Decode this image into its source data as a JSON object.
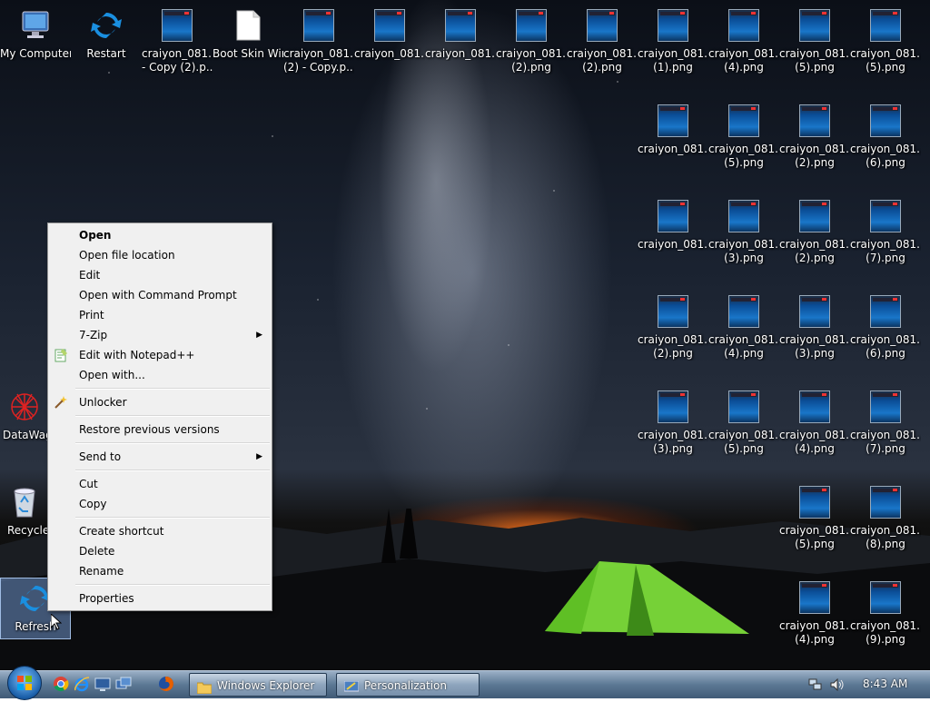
{
  "desktop": {
    "icons": [
      {
        "label": "My Computer",
        "type": "computer"
      },
      {
        "label": "Restart",
        "type": "refresh"
      },
      {
        "label": "craiyon_081... - Copy (2).p...",
        "type": "thumb"
      },
      {
        "label": "Boot Skin Windo...",
        "type": "file"
      },
      {
        "label": "craiyon_081... (2) - Copy.p...",
        "type": "thumb"
      },
      {
        "label": "craiyon_081...",
        "type": "thumb"
      },
      {
        "label": "craiyon_081...",
        "type": "thumb"
      },
      {
        "label": "craiyon_081... (2).png",
        "type": "thumb"
      },
      {
        "label": "craiyon_081... (2).png",
        "type": "thumb"
      },
      {
        "label": "craiyon_081... (1).png",
        "type": "thumb"
      },
      {
        "label": "craiyon_081... (4).png",
        "type": "thumb"
      },
      {
        "label": "craiyon_081... (5).png",
        "type": "thumb"
      },
      {
        "label": "craiyon_081... (5).png",
        "type": "thumb"
      },
      {
        "label": "craiyon_081...",
        "type": "thumb"
      },
      {
        "label": "craiyon_081... (5).png",
        "type": "thumb"
      },
      {
        "label": "craiyon_081... (2).png",
        "type": "thumb"
      },
      {
        "label": "craiyon_081... (6).png",
        "type": "thumb"
      },
      {
        "label": "craiyon_081...",
        "type": "thumb"
      },
      {
        "label": "craiyon_081... (3).png",
        "type": "thumb"
      },
      {
        "label": "craiyon_081... (2).png",
        "type": "thumb"
      },
      {
        "label": "craiyon_081... (7).png",
        "type": "thumb"
      },
      {
        "label": "craiyon_081... (2).png",
        "type": "thumb"
      },
      {
        "label": "craiyon_081... (4).png",
        "type": "thumb"
      },
      {
        "label": "craiyon_081... (3).png",
        "type": "thumb"
      },
      {
        "label": "craiyon_081... (6).png",
        "type": "thumb"
      },
      {
        "label": "craiyon_081... (3).png",
        "type": "thumb"
      },
      {
        "label": "craiyon_081... (5).png",
        "type": "thumb"
      },
      {
        "label": "craiyon_081... (4).png",
        "type": "thumb"
      },
      {
        "label": "craiyon_081... (7).png",
        "type": "thumb"
      },
      {
        "label": "craiyon_081... (5).png",
        "type": "thumb"
      },
      {
        "label": "craiyon_081... (8).png",
        "type": "thumb"
      },
      {
        "label": "craiyon_081... (4).png",
        "type": "thumb"
      },
      {
        "label": "craiyon_081... (9).png",
        "type": "thumb"
      },
      {
        "label": "DataWag",
        "type": "datawag"
      },
      {
        "label": "Recycle",
        "type": "recycle"
      },
      {
        "label": "Refresh",
        "type": "refresh"
      }
    ]
  },
  "context_menu": {
    "items": [
      {
        "label": "Open",
        "bold": true
      },
      {
        "label": "Open file location"
      },
      {
        "label": "Edit"
      },
      {
        "label": "Open with Command Prompt"
      },
      {
        "label": "Print"
      },
      {
        "label": "7-Zip",
        "submenu": true
      },
      {
        "label": "Edit with Notepad++",
        "icon": "notepad-icon"
      },
      {
        "label": "Open with..."
      },
      {
        "separator": true
      },
      {
        "label": "Unlocker",
        "icon": "wand-icon"
      },
      {
        "separator": true
      },
      {
        "label": "Restore previous versions"
      },
      {
        "separator": true
      },
      {
        "label": "Send to",
        "submenu": true
      },
      {
        "separator": true
      },
      {
        "label": "Cut"
      },
      {
        "label": "Copy"
      },
      {
        "separator": true
      },
      {
        "label": "Create shortcut"
      },
      {
        "label": "Delete"
      },
      {
        "label": "Rename"
      },
      {
        "separator": true
      },
      {
        "label": "Properties"
      }
    ]
  },
  "taskbar": {
    "quicklaunch": [
      "chrome-icon",
      "ie-icon",
      "show-desktop-icon",
      "switch-windows-icon",
      "firefox-icon"
    ],
    "tasks": [
      {
        "label": "Windows Explorer",
        "icon": "folder-icon"
      },
      {
        "label": "Personalization",
        "icon": "personalization-icon"
      }
    ],
    "clock": "8:43 AM",
    "tray": [
      "network-icon",
      "volume-icon"
    ]
  },
  "colors": {
    "menu_bg": "#f0f0f0",
    "taskbar": "#5c7894",
    "tent": "#7cdc3a"
  }
}
